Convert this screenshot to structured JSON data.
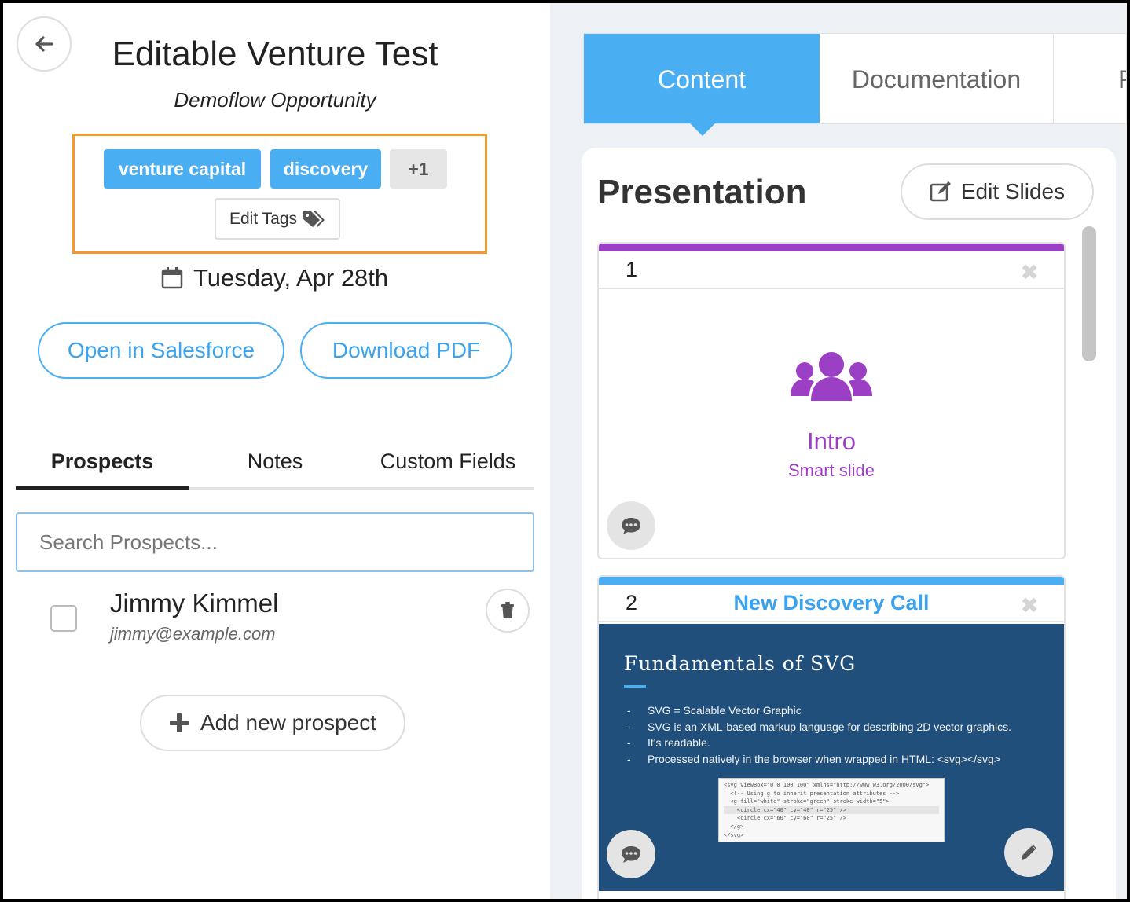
{
  "header": {
    "title": "Editable Venture Test",
    "subtitle": "Demoflow Opportunity"
  },
  "tags": {
    "items": [
      "venture capital",
      "discovery"
    ],
    "more": "+1",
    "edit_label": "Edit Tags"
  },
  "date": "Tuesday, Apr 28th",
  "actions": {
    "salesforce": "Open in Salesforce",
    "pdf": "Download PDF"
  },
  "left_tabs": [
    "Prospects",
    "Notes",
    "Custom Fields"
  ],
  "search": {
    "placeholder": "Search Prospects..."
  },
  "prospects": [
    {
      "name": "Jimmy Kimmel",
      "email": "jimmy@example.com"
    }
  ],
  "add_prospect": "Add new prospect",
  "right_tabs": [
    "Content",
    "Documentation",
    "F"
  ],
  "presentation": {
    "title": "Presentation",
    "edit_label": "Edit Slides",
    "slides": [
      {
        "number": "1",
        "name": "",
        "label": "Intro",
        "sublabel": "Smart slide",
        "color": "#9b3fc4"
      },
      {
        "number": "2",
        "name": "New Discovery Call",
        "color": "#4aaef3",
        "preview": {
          "title": "Fundamentals of SVG",
          "bullets": [
            "SVG = Scalable Vector Graphic",
            "SVG is an XML-based markup language for describing 2D vector graphics.",
            "It's readable.",
            "Processed natively in the browser when wrapped in HTML: <svg></svg>"
          ],
          "code": [
            "<svg viewBox=\"0 0 100 100\" xmlns=\"http://www.w3.org/2000/svg\">",
            "  <!-- Using g to inherit presentation attributes -->",
            "  <g fill=\"white\" stroke=\"green\" stroke-width=\"5\">",
            "    <circle cx=\"40\" cy=\"40\" r=\"25\" />",
            "    <circle cx=\"60\" cy=\"60\" r=\"25\" />",
            "  </g>",
            "</svg>"
          ]
        }
      }
    ]
  },
  "colors": {
    "accent": "#4aaef3",
    "highlight_border": "#f29a2e",
    "smart_slide": "#9b3fc4",
    "slide_bg": "#1f4f7a"
  }
}
